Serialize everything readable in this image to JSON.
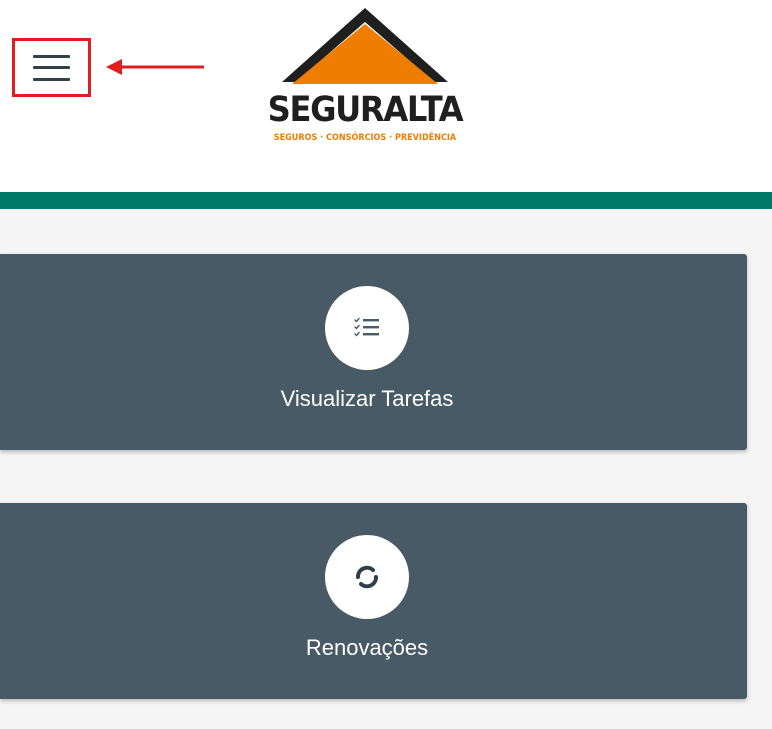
{
  "header": {
    "menu_icon": "hamburger-menu-icon",
    "annotation_arrow_color": "#e11d1d",
    "logo": {
      "name": "SEGURALTA",
      "tagline": "SEGUROS · CONSÓRCIOS · PREVIDÊNCIA",
      "roof_color": "#ef7d00",
      "roof_outline_color": "#1f1f1f"
    },
    "accent_bar_color": "#00796b"
  },
  "cards": [
    {
      "icon": "task-list-icon",
      "label": "Visualizar Tarefas"
    },
    {
      "icon": "renew-icon",
      "label": "Renovações"
    }
  ],
  "card_color": "#475a66"
}
